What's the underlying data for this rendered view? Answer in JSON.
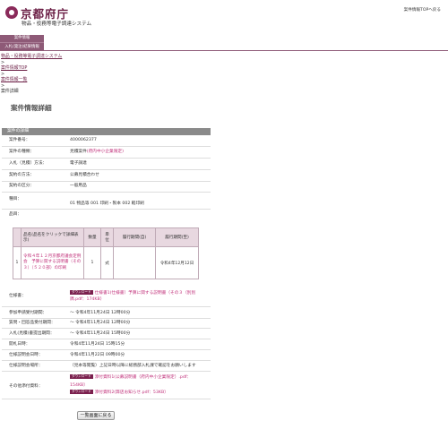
{
  "header": {
    "logo_text": "京都府庁",
    "system_name": "物品・役務等電子調達システム",
    "top_link": "案件情報TOPへ戻る",
    "tab_primary": "案件情報",
    "tab_secondary": "入札(発注)結果情報"
  },
  "breadcrumbs": [
    {
      "label": "物品・役務等電子調達システム",
      "link": true
    },
    {
      "label": ">",
      "link": false
    },
    {
      "label": "案件情報TOP",
      "link": true
    },
    {
      "label": ">",
      "link": false
    },
    {
      "label": "案件情報一覧",
      "link": true
    },
    {
      "label": ">",
      "link": false
    },
    {
      "label": "案件詳細",
      "link": false
    }
  ],
  "page_title": "案件情報詳細",
  "section_title": "案件の詳細",
  "details": {
    "case_no_label": "案件番号：",
    "case_no": "4000062377",
    "type_label": "案件の種類：",
    "type_value": "見積案件",
    "type_note": "(府内中小企業限定)",
    "bid_method_label": "入札（見積）方法：",
    "bid_method": "電子調達",
    "contract_method_label": "契約の方法：",
    "contract_method": "公募見積合わせ",
    "contract_class_label": "契約の区分：",
    "contract_class": "一般用品",
    "category_label": "種目：",
    "category": "01  物品等  001  印刷・製本  002  軽印刷",
    "item_label": "品目："
  },
  "items_table": {
    "headers": [
      "品名(品名をクリックで詳細表示)",
      "数量",
      "単位",
      "履行期間(自)",
      "履行期間(至)"
    ],
    "rows": [
      {
        "no": "1",
        "name": "令和４年１２月京都府議会定例会　予算に関する説明書（その３）（５２０部）の印刷",
        "qty": "1",
        "unit": "式",
        "from": "",
        "to": "令和4年12月12日"
      }
    ]
  },
  "specs": {
    "label": "仕様書：",
    "badge": "ダウンロード",
    "file": "仕様書1(仕様書）予算に関する説明書（その３（別別隅.pdf：174KB）"
  },
  "schedule": [
    {
      "label": "参加申請受付期間：",
      "value": "～ 令和4年11月24日 12時00分"
    },
    {
      "label": "質問・回答品受付期間：",
      "value": "～ 令和4年11月24日 12時00分"
    },
    {
      "label": "入札(見積)書提出期間：",
      "value": "～ 令和4年11月24日 15時00分"
    },
    {
      "label": "開札日時：",
      "value": "令和4年11月24日 15時15分"
    },
    {
      "label": "仕様説明会日時：",
      "value": "令和4年11月22日 09時00分"
    },
    {
      "label": "仕様説明会場所：",
      "value": "（見本等閲覧）上記日時以降に総務部入札課で確認をお願いします"
    }
  ],
  "other_files": {
    "label": "その他添付資料：",
    "badge": "ダウンロード",
    "file1": "添付資料1(公募説明書（府内中小企業限定）.pdf：",
    "file1_size": "154KB）",
    "file2": "添付資料2(弊店お知らせ.pdf：53KB）"
  },
  "back_button": "一覧画面に戻る",
  "colors": {
    "brand": "#6b1e45",
    "tab_bg": "#8e5a77",
    "link": "#c0307a",
    "section_header": "#8a8a8a"
  }
}
